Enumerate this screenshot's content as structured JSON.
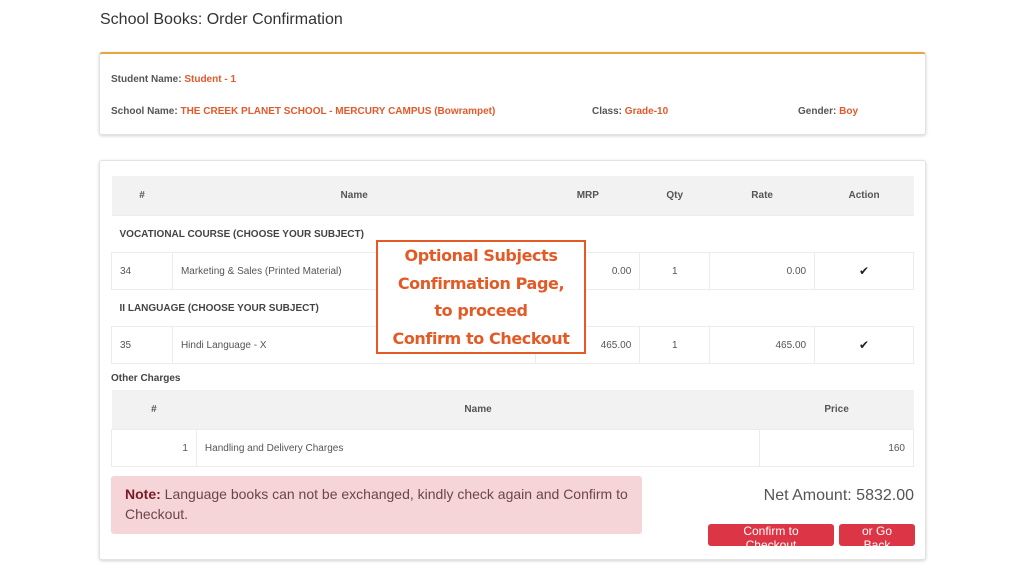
{
  "page": {
    "title": "School Books: Order Confirmation"
  },
  "student": {
    "name_label": "Student Name:",
    "name": "Student - 1",
    "school_label": "School Name:",
    "school": "THE CREEK PLANET SCHOOL - MERCURY CAMPUS (Bowrampet)",
    "class_label": "Class:",
    "class": "Grade-10",
    "gender_label": "Gender:",
    "gender": "Boy"
  },
  "items_table": {
    "headers": [
      "#",
      "Name",
      "MRP",
      "Qty",
      "Rate",
      "Action"
    ],
    "sections": [
      {
        "title": "VOCATIONAL COURSE (CHOOSE YOUR SUBJECT)",
        "rows": [
          {
            "id": "34",
            "name": "Marketing & Sales (Printed Material)",
            "mrp": "0.00",
            "qty": "1",
            "rate": "0.00",
            "action_icon": "check-icon",
            "action": "✔"
          }
        ]
      },
      {
        "title": "II LANGUAGE (CHOOSE YOUR SUBJECT)",
        "rows": [
          {
            "id": "35",
            "name": "Hindi Language - X",
            "mrp": "465.00",
            "qty": "1",
            "rate": "465.00",
            "action_icon": "check-icon",
            "action": "✔"
          }
        ]
      }
    ]
  },
  "other_charges": {
    "title": "Other Charges",
    "headers": [
      "#",
      "Name",
      "Price"
    ],
    "rows": [
      {
        "id": "1",
        "name": "Handling and Delivery Charges",
        "price": "160"
      }
    ]
  },
  "note": {
    "label": "Note:",
    "text": " Language books can not be exchanged, kindly check again and Confirm to Checkout."
  },
  "summary": {
    "net_amount": "Net Amount: 5832.00"
  },
  "buttons": {
    "confirm": "Confirm to Checkout",
    "back": "or Go Back"
  },
  "callout": {
    "lines": [
      "Optional Subjects",
      "Confirmation Page,",
      "to proceed",
      "Confirm to Checkout"
    ]
  },
  "colors": {
    "accent_orange": "#e05a2b",
    "top_border": "#e8a73c",
    "button_red": "#dc3545",
    "note_bg": "#f5d5d8"
  }
}
